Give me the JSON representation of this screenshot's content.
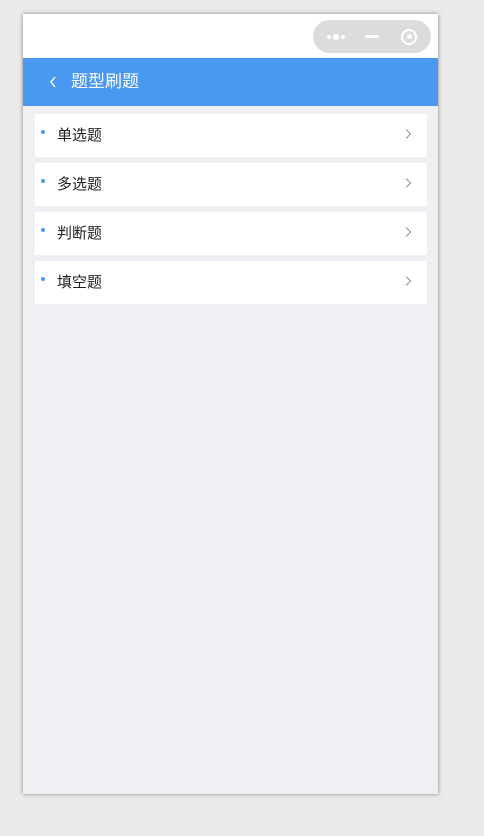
{
  "colors": {
    "accent": "#4a99f0",
    "page_background": "#efeff4",
    "capsule": "#dcdcdc"
  },
  "capsule": {
    "icons": [
      "more-dots-icon",
      "minimize-icon",
      "close-circle-icon"
    ]
  },
  "header": {
    "back_icon": "chevron-left-icon",
    "title": "题型刷题"
  },
  "list": {
    "items": [
      {
        "label": "单选题",
        "icon": "chevron-right-icon"
      },
      {
        "label": "多选题",
        "icon": "chevron-right-icon"
      },
      {
        "label": "判断题",
        "icon": "chevron-right-icon"
      },
      {
        "label": "填空题",
        "icon": "chevron-right-icon"
      }
    ]
  }
}
